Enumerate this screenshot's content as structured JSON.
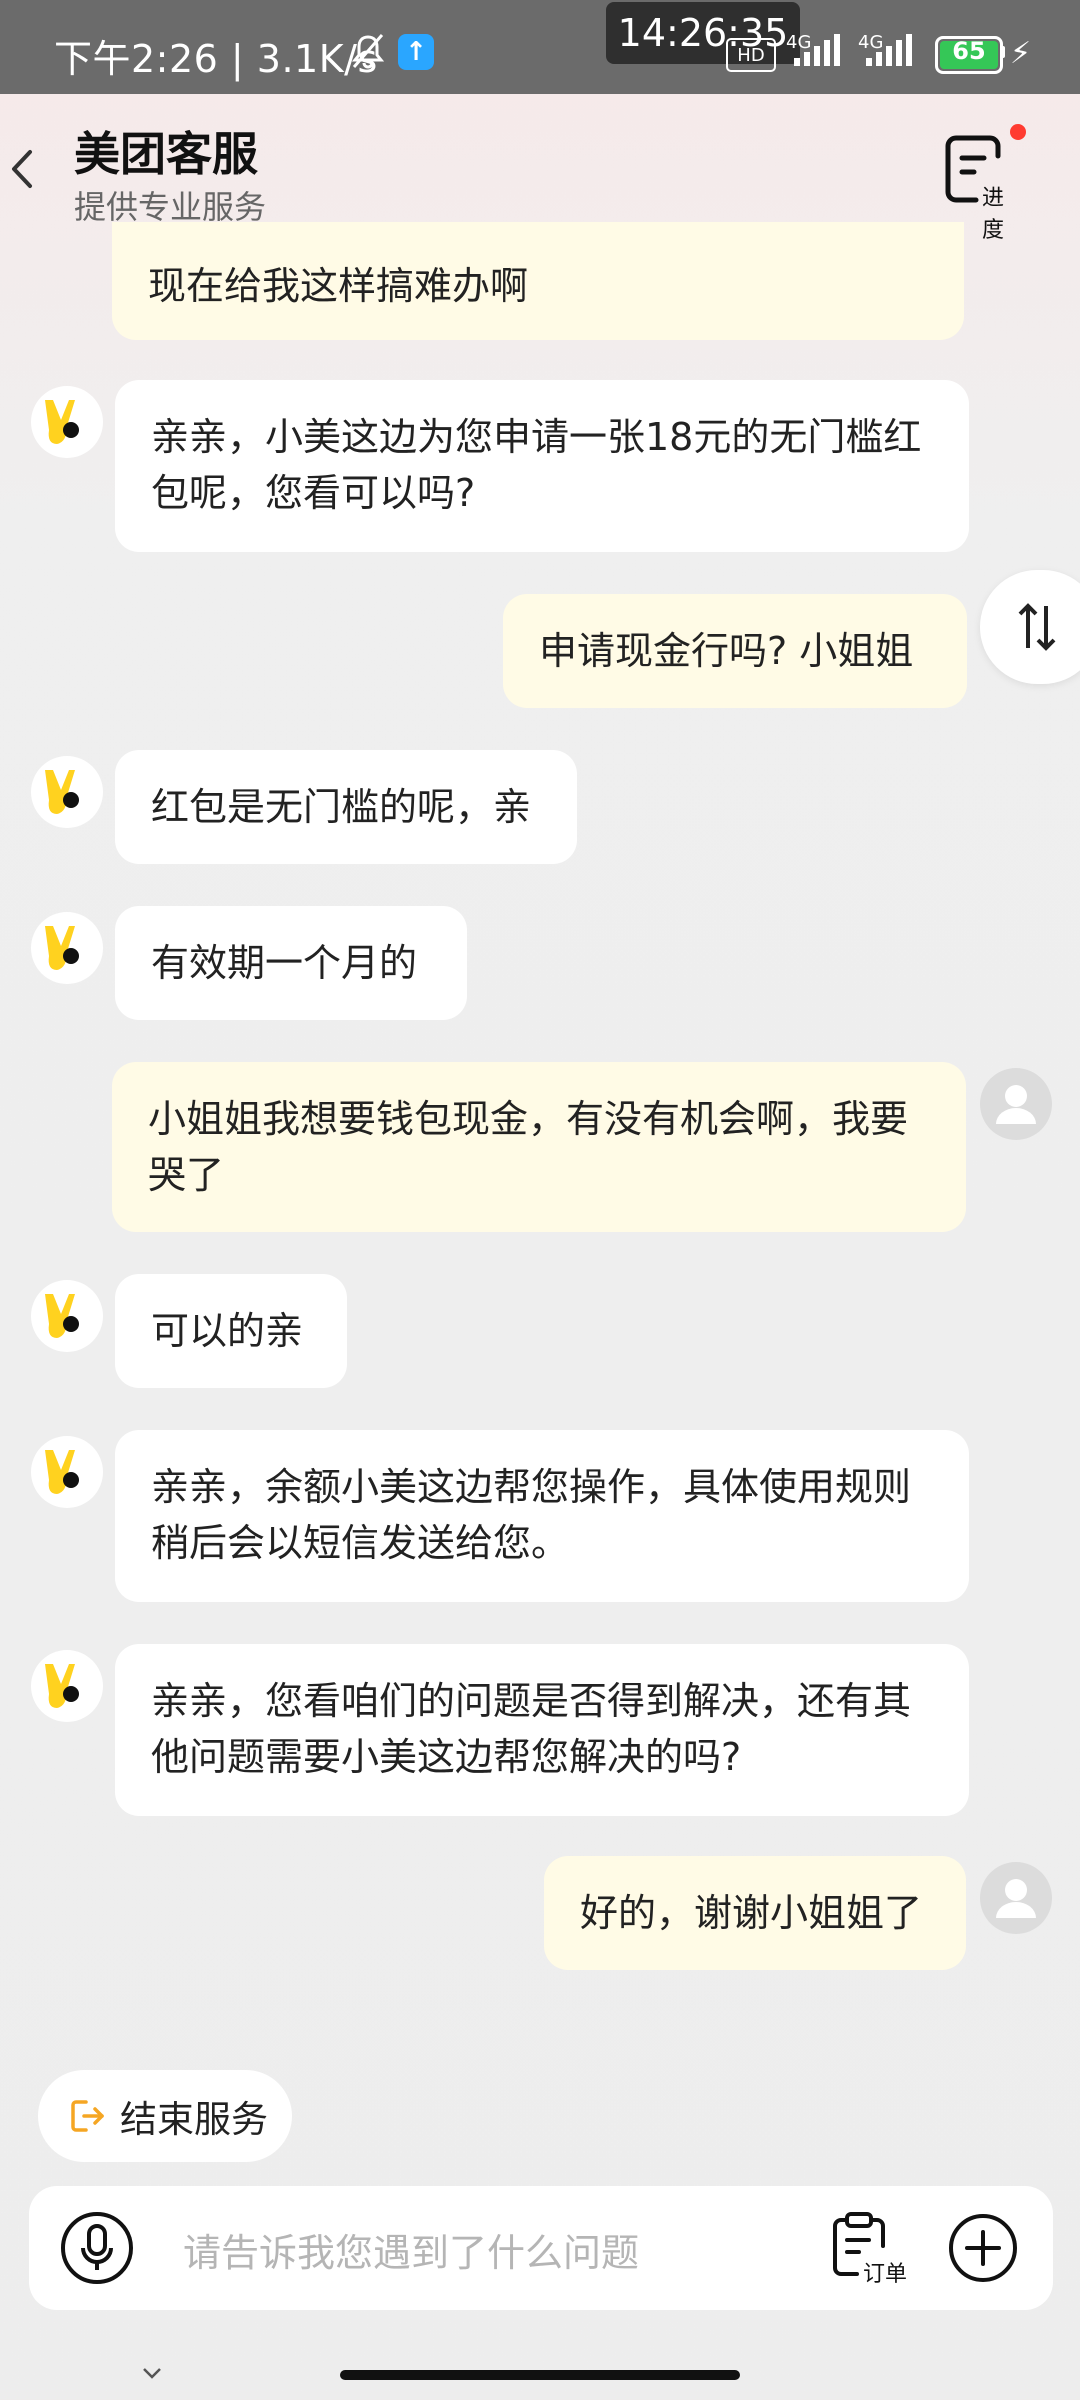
{
  "status_bar": {
    "left_text": "下午2:26 | 3.1K/s",
    "time_chip": "14:26:35",
    "hd_label": "HD",
    "network_1": "4G",
    "network_2": "4G",
    "battery_level": "65"
  },
  "header": {
    "title": "美团客服",
    "subtitle": "提供专业服务",
    "progress_label": "进度"
  },
  "messages": [
    {
      "from": "user",
      "text": "现在给我这样搞难办啊"
    },
    {
      "from": "bot",
      "text": "亲亲，小美这边为您申请一张18元的无门槛红包呢，您看可以吗?"
    },
    {
      "from": "user",
      "text": "申请现金行吗? 小姐姐"
    },
    {
      "from": "bot",
      "text": "红包是无门槛的呢，亲"
    },
    {
      "from": "bot",
      "text": "有效期一个月的"
    },
    {
      "from": "user",
      "text": "小姐姐我想要钱包现金，有没有机会啊，我要哭了"
    },
    {
      "from": "bot",
      "text": "可以的亲"
    },
    {
      "from": "bot",
      "text": "亲亲，余额小美这边帮您操作，具体使用规则稍后会以短信发送给您。"
    },
    {
      "from": "bot",
      "text": "亲亲，您看咱们的问题是否得到解决，还有其他问题需要小美这边帮您解决的吗?"
    },
    {
      "from": "user",
      "text": "好的，谢谢小姐姐了"
    }
  ],
  "end_service_label": "结束服务",
  "input": {
    "placeholder": "请告诉我您遇到了什么问题",
    "order_label": "订单"
  },
  "colors": {
    "user_bubble": "#fffbe6",
    "bot_bubble": "#ffffff",
    "mascot_yellow": "#ffd21f",
    "end_icon_orange": "#f5a623"
  }
}
